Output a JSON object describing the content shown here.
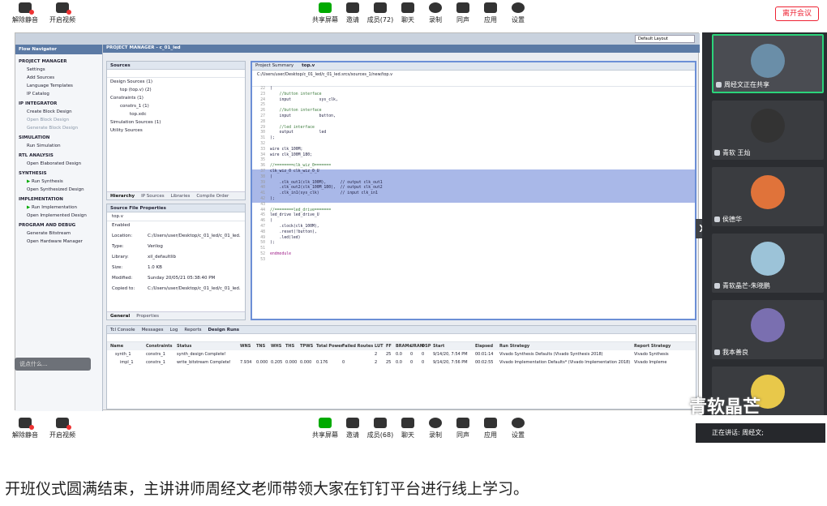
{
  "meeting": {
    "top_left": [
      {
        "label": "解除静音",
        "icon": "mic-muted-icon"
      },
      {
        "label": "开启视频",
        "icon": "camera-off-icon"
      }
    ],
    "top_center": [
      {
        "label": "共享屏幕",
        "icon": "screen-share-icon"
      },
      {
        "label": "邀请",
        "icon": "invite-icon"
      },
      {
        "label": "成员(72)",
        "icon": "members-icon"
      },
      {
        "label": "聊天",
        "icon": "chat-icon"
      },
      {
        "label": "录制",
        "icon": "record-icon"
      },
      {
        "label": "同声",
        "icon": "interpret-icon"
      },
      {
        "label": "应用",
        "icon": "apps-icon"
      },
      {
        "label": "设置",
        "icon": "settings-icon"
      }
    ],
    "bottom_left": [
      {
        "label": "解除静音",
        "icon": "mic-muted-icon"
      },
      {
        "label": "开启视频",
        "icon": "camera-off-icon"
      }
    ],
    "bottom_center": [
      {
        "label": "共享屏幕",
        "icon": "screen-share-icon"
      },
      {
        "label": "邀请",
        "icon": "invite-icon"
      },
      {
        "label": "成员(68)",
        "icon": "members-icon"
      },
      {
        "label": "聊天",
        "icon": "chat-icon"
      },
      {
        "label": "录制",
        "icon": "record-icon"
      },
      {
        "label": "同声",
        "icon": "interpret-icon"
      },
      {
        "label": "应用",
        "icon": "apps-icon"
      },
      {
        "label": "设置",
        "icon": "settings-icon"
      }
    ],
    "leave_label": "离开会议",
    "chat_placeholder": "说点什么...",
    "speaking_label": "正在讲话: 周经文;",
    "watermark": "青软晶芒",
    "participants": [
      {
        "name": "周经文正在共享",
        "active": true,
        "avatar_color": "#6a8ea8"
      },
      {
        "name": "青软 王灿",
        "active": false,
        "avatar_color": "#333"
      },
      {
        "name": "侯德华",
        "active": false,
        "avatar_color": "#e0733a"
      },
      {
        "name": "青软晶芒-朱晓鹏",
        "active": false,
        "avatar_color": "#9cc3d8"
      },
      {
        "name": "我本善良",
        "active": false,
        "avatar_color": "#7a6fb0"
      },
      {
        "name": "",
        "active": false,
        "avatar_color": "#e8c84a"
      }
    ]
  },
  "vivado": {
    "menubar_layout": "Default Layout",
    "project_bar": "PROJECT MANAGER - c_01_led",
    "flow_nav_title": "Flow Navigator",
    "flow_nav": [
      {
        "type": "sec",
        "label": "PROJECT MANAGER"
      },
      {
        "type": "item",
        "label": "Settings"
      },
      {
        "type": "item",
        "label": "Add Sources"
      },
      {
        "type": "item",
        "label": "Language Templates"
      },
      {
        "type": "item",
        "label": "IP Catalog"
      },
      {
        "type": "sec",
        "label": "IP INTEGRATOR"
      },
      {
        "type": "item",
        "label": "Create Block Design"
      },
      {
        "type": "dim",
        "label": "Open Block Design"
      },
      {
        "type": "dim",
        "label": "Generate Block Design"
      },
      {
        "type": "sec",
        "label": "SIMULATION"
      },
      {
        "type": "item",
        "label": "Run Simulation"
      },
      {
        "type": "sec",
        "label": "RTL ANALYSIS"
      },
      {
        "type": "item",
        "label": "Open Elaborated Design"
      },
      {
        "type": "sec",
        "label": "SYNTHESIS"
      },
      {
        "type": "run",
        "label": "Run Synthesis"
      },
      {
        "type": "item",
        "label": "Open Synthesized Design"
      },
      {
        "type": "sec",
        "label": "IMPLEMENTATION"
      },
      {
        "type": "run",
        "label": "Run Implementation"
      },
      {
        "type": "item",
        "label": "Open Implemented Design"
      },
      {
        "type": "sec",
        "label": "PROGRAM AND DEBUG"
      },
      {
        "type": "item",
        "label": "Generate Bitstream"
      },
      {
        "type": "item",
        "label": "Open Hardware Manager"
      }
    ],
    "sources": {
      "title": "Sources",
      "rows": [
        "Design Sources (1)",
        "top (top.v) (2)",
        "Constraints (1)",
        "constrs_1 (1)",
        "top.xdc",
        "Simulation Sources (1)",
        "Utility Sources"
      ],
      "tabs": [
        "Hierarchy",
        "IP Sources",
        "Libraries",
        "Compile Order"
      ]
    },
    "props": {
      "title": "Source File Properties",
      "file": "top.v",
      "fields": [
        {
          "k": "Enabled",
          "v": ""
        },
        {
          "k": "Location:",
          "v": "C:/Users/user/Desktop/c_01_led/c_01_led.srcs/"
        },
        {
          "k": "Type:",
          "v": "Verilog"
        },
        {
          "k": "Library:",
          "v": "xil_defaultlib"
        },
        {
          "k": "Size:",
          "v": "1.0 KB"
        },
        {
          "k": "Modified:",
          "v": "Sunday 20/05/21 05:38:40 PM"
        },
        {
          "k": "Copied to:",
          "v": "C:/Users/user/Desktop/c_01_led/c_01_led.srcs/"
        }
      ],
      "tabs": [
        "General",
        "Properties"
      ]
    },
    "editor": {
      "tabs": [
        "Project Summary",
        "top.v"
      ],
      "path": "C:/Users/user/Desktop/c_01_led/c_01_led.srcs/sources_1/new/top.v",
      "lines": [
        {
          "n": "22",
          "t": "(",
          "hl": false
        },
        {
          "n": "23",
          "t": "    //button interface",
          "hl": false,
          "c": "cm"
        },
        {
          "n": "24",
          "t": "    input            sys_clk,",
          "hl": false
        },
        {
          "n": "25",
          "t": "",
          "hl": false
        },
        {
          "n": "26",
          "t": "    //button interface",
          "hl": false,
          "c": "cm"
        },
        {
          "n": "27",
          "t": "    input            button,",
          "hl": false
        },
        {
          "n": "28",
          "t": "",
          "hl": false
        },
        {
          "n": "29",
          "t": "    //led interface",
          "hl": false,
          "c": "cm"
        },
        {
          "n": "30",
          "t": "    output           led",
          "hl": false
        },
        {
          "n": "31",
          "t": ");",
          "hl": false
        },
        {
          "n": "32",
          "t": "",
          "hl": false
        },
        {
          "n": "33",
          "t": "wire clk_100M;",
          "hl": false
        },
        {
          "n": "34",
          "t": "wire clk_100M_180;",
          "hl": false
        },
        {
          "n": "35",
          "t": "",
          "hl": false
        },
        {
          "n": "36",
          "t": "//========clk_wiz_0=======",
          "hl": false,
          "c": "cm"
        },
        {
          "n": "37",
          "t": "clk_wiz_0 clk_wiz_0_U",
          "hl": true
        },
        {
          "n": "38",
          "t": "(",
          "hl": true
        },
        {
          "n": "39",
          "t": "    .clk_out1(clk_100M),      // output clk_out1",
          "hl": true
        },
        {
          "n": "40",
          "t": "    .clk_out2(clk_100M_180),  // output clk_out2",
          "hl": true
        },
        {
          "n": "41",
          "t": "    .clk_in1(sys_clk)         // input clk_in1",
          "hl": true
        },
        {
          "n": "42",
          "t": ");",
          "hl": true
        },
        {
          "n": "43",
          "t": "",
          "hl": false
        },
        {
          "n": "44",
          "t": "//========led_drive=======",
          "hl": false,
          "c": "cm"
        },
        {
          "n": "45",
          "t": "led_drive led_drive_U",
          "hl": false
        },
        {
          "n": "46",
          "t": "(",
          "hl": false
        },
        {
          "n": "47",
          "t": "    .clock(clk_100M),",
          "hl": false
        },
        {
          "n": "48",
          "t": "    .reset(!button),",
          "hl": false
        },
        {
          "n": "49",
          "t": "    .led(led)",
          "hl": false
        },
        {
          "n": "50",
          "t": ");",
          "hl": false
        },
        {
          "n": "51",
          "t": "",
          "hl": false
        },
        {
          "n": "52",
          "t": "endmodule",
          "hl": false,
          "c": "kw"
        },
        {
          "n": "53",
          "t": "",
          "hl": false
        }
      ]
    },
    "runs": {
      "tabs": [
        "Tcl Console",
        "Messages",
        "Log",
        "Reports",
        "Design Runs"
      ],
      "headers": [
        "Name",
        "Constraints",
        "Status",
        "WNS",
        "TNS",
        "WHS",
        "THS",
        "TPWS",
        "Total Power",
        "Failed Routes",
        "LUT",
        "FF",
        "BRAMs",
        "URAM",
        "DSP",
        "Start",
        "Elapsed",
        "Run Strategy",
        "Report Strategy"
      ],
      "rows": [
        [
          "synth_1",
          "constrs_1",
          "synth_design Complete!",
          "",
          "",
          "",
          "",
          "",
          "",
          "",
          "2",
          "25",
          "0.0",
          "0",
          "0",
          "9/14/20, 7:54 PM",
          "00:01:14",
          "Vivado Synthesis Defaults (Vivado Synthesis 2018)",
          "Vivado Synthesis"
        ],
        [
          "impl_1",
          "constrs_1",
          "write_bitstream Complete!",
          "7.934",
          "0.000",
          "0.205",
          "0.000",
          "0.000",
          "0.176",
          "0",
          "2",
          "25",
          "0.0",
          "0",
          "0",
          "9/14/20, 7:56 PM",
          "00:02:55",
          "Vivado Implementation Defaults* (Vivado Implementation 2018)",
          "Vivado Impleme"
        ]
      ]
    }
  },
  "caption": "开班仪式圆满结束，主讲讲师周经文老师带领大家在钉钉平台进行线上学习。"
}
